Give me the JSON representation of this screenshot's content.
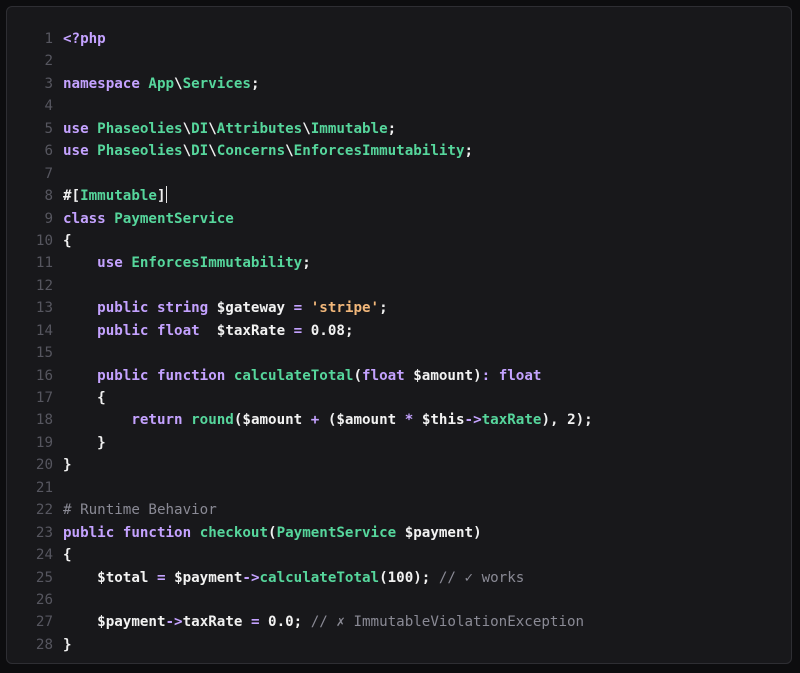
{
  "editor": {
    "lines": [
      [
        {
          "t": "kw",
          "v": "<?php"
        }
      ],
      [],
      [
        {
          "t": "kw",
          "v": "namespace"
        },
        {
          "t": "plain",
          "v": " "
        },
        {
          "t": "cls",
          "v": "App"
        },
        {
          "t": "sep",
          "v": "\\"
        },
        {
          "t": "cls",
          "v": "Services"
        },
        {
          "t": "plain",
          "v": ";"
        }
      ],
      [],
      [
        {
          "t": "kw",
          "v": "use"
        },
        {
          "t": "plain",
          "v": " "
        },
        {
          "t": "cls",
          "v": "Phaseolies"
        },
        {
          "t": "sep",
          "v": "\\"
        },
        {
          "t": "cls",
          "v": "DI"
        },
        {
          "t": "sep",
          "v": "\\"
        },
        {
          "t": "cls",
          "v": "Attributes"
        },
        {
          "t": "sep",
          "v": "\\"
        },
        {
          "t": "cls",
          "v": "Immutable"
        },
        {
          "t": "plain",
          "v": ";"
        }
      ],
      [
        {
          "t": "kw",
          "v": "use"
        },
        {
          "t": "plain",
          "v": " "
        },
        {
          "t": "cls",
          "v": "Phaseolies"
        },
        {
          "t": "sep",
          "v": "\\"
        },
        {
          "t": "cls",
          "v": "DI"
        },
        {
          "t": "sep",
          "v": "\\"
        },
        {
          "t": "cls",
          "v": "Concerns"
        },
        {
          "t": "sep",
          "v": "\\"
        },
        {
          "t": "cls",
          "v": "EnforcesImmutability"
        },
        {
          "t": "plain",
          "v": ";"
        }
      ],
      [],
      [
        {
          "t": "plain",
          "v": "#["
        },
        {
          "t": "cls",
          "v": "Immutable"
        },
        {
          "t": "plain",
          "v": "]"
        },
        {
          "t": "cursor",
          "v": ""
        }
      ],
      [
        {
          "t": "kw",
          "v": "class"
        },
        {
          "t": "plain",
          "v": " "
        },
        {
          "t": "cls",
          "v": "PaymentService"
        }
      ],
      [
        {
          "t": "plain",
          "v": "{"
        }
      ],
      [
        {
          "t": "plain",
          "v": "    "
        },
        {
          "t": "kw",
          "v": "use"
        },
        {
          "t": "plain",
          "v": " "
        },
        {
          "t": "cls",
          "v": "EnforcesImmutability"
        },
        {
          "t": "plain",
          "v": ";"
        }
      ],
      [],
      [
        {
          "t": "plain",
          "v": "    "
        },
        {
          "t": "kw",
          "v": "public"
        },
        {
          "t": "plain",
          "v": " "
        },
        {
          "t": "kw",
          "v": "string"
        },
        {
          "t": "plain",
          "v": " "
        },
        {
          "t": "var",
          "v": "$gateway"
        },
        {
          "t": "plain",
          "v": " "
        },
        {
          "t": "op",
          "v": "="
        },
        {
          "t": "plain",
          "v": " "
        },
        {
          "t": "str",
          "v": "'stripe'"
        },
        {
          "t": "plain",
          "v": ";"
        }
      ],
      [
        {
          "t": "plain",
          "v": "    "
        },
        {
          "t": "kw",
          "v": "public"
        },
        {
          "t": "plain",
          "v": " "
        },
        {
          "t": "kw",
          "v": "float"
        },
        {
          "t": "plain",
          "v": "  "
        },
        {
          "t": "var",
          "v": "$taxRate"
        },
        {
          "t": "plain",
          "v": " "
        },
        {
          "t": "op",
          "v": "="
        },
        {
          "t": "plain",
          "v": " "
        },
        {
          "t": "num",
          "v": "0.08"
        },
        {
          "t": "plain",
          "v": ";"
        }
      ],
      [],
      [
        {
          "t": "plain",
          "v": "    "
        },
        {
          "t": "kw",
          "v": "public"
        },
        {
          "t": "plain",
          "v": " "
        },
        {
          "t": "kw",
          "v": "function"
        },
        {
          "t": "plain",
          "v": " "
        },
        {
          "t": "fn",
          "v": "calculateTotal"
        },
        {
          "t": "plain",
          "v": "("
        },
        {
          "t": "kw",
          "v": "float"
        },
        {
          "t": "plain",
          "v": " "
        },
        {
          "t": "var",
          "v": "$amount"
        },
        {
          "t": "plain",
          "v": ")"
        },
        {
          "t": "op",
          "v": ":"
        },
        {
          "t": "plain",
          "v": " "
        },
        {
          "t": "kw",
          "v": "float"
        }
      ],
      [
        {
          "t": "plain",
          "v": "    {"
        }
      ],
      [
        {
          "t": "plain",
          "v": "        "
        },
        {
          "t": "kw",
          "v": "return"
        },
        {
          "t": "plain",
          "v": " "
        },
        {
          "t": "fn",
          "v": "round"
        },
        {
          "t": "plain",
          "v": "("
        },
        {
          "t": "var",
          "v": "$amount"
        },
        {
          "t": "plain",
          "v": " "
        },
        {
          "t": "op",
          "v": "+"
        },
        {
          "t": "plain",
          "v": " ("
        },
        {
          "t": "var",
          "v": "$amount"
        },
        {
          "t": "plain",
          "v": " "
        },
        {
          "t": "op",
          "v": "*"
        },
        {
          "t": "plain",
          "v": " "
        },
        {
          "t": "var",
          "v": "$this"
        },
        {
          "t": "op",
          "v": "->"
        },
        {
          "t": "fn",
          "v": "taxRate"
        },
        {
          "t": "plain",
          "v": "), "
        },
        {
          "t": "num",
          "v": "2"
        },
        {
          "t": "plain",
          "v": ");"
        }
      ],
      [
        {
          "t": "plain",
          "v": "    }"
        }
      ],
      [
        {
          "t": "plain",
          "v": "}"
        }
      ],
      [],
      [
        {
          "t": "cmt",
          "v": "# Runtime Behavior"
        }
      ],
      [
        {
          "t": "kw",
          "v": "public"
        },
        {
          "t": "plain",
          "v": " "
        },
        {
          "t": "kw",
          "v": "function"
        },
        {
          "t": "plain",
          "v": " "
        },
        {
          "t": "fn",
          "v": "checkout"
        },
        {
          "t": "plain",
          "v": "("
        },
        {
          "t": "cls",
          "v": "PaymentService"
        },
        {
          "t": "plain",
          "v": " "
        },
        {
          "t": "var",
          "v": "$payment"
        },
        {
          "t": "plain",
          "v": ")"
        }
      ],
      [
        {
          "t": "plain",
          "v": "{"
        }
      ],
      [
        {
          "t": "plain",
          "v": "    "
        },
        {
          "t": "var",
          "v": "$total"
        },
        {
          "t": "plain",
          "v": " "
        },
        {
          "t": "op",
          "v": "="
        },
        {
          "t": "plain",
          "v": " "
        },
        {
          "t": "var",
          "v": "$payment"
        },
        {
          "t": "op",
          "v": "->"
        },
        {
          "t": "fn",
          "v": "calculateTotal"
        },
        {
          "t": "plain",
          "v": "("
        },
        {
          "t": "num",
          "v": "100"
        },
        {
          "t": "plain",
          "v": "); "
        },
        {
          "t": "cmt",
          "v": "// ✓ works"
        }
      ],
      [],
      [
        {
          "t": "plain",
          "v": "    "
        },
        {
          "t": "var",
          "v": "$payment"
        },
        {
          "t": "op",
          "v": "->"
        },
        {
          "t": "plain",
          "v": "taxRate "
        },
        {
          "t": "op",
          "v": "="
        },
        {
          "t": "plain",
          "v": " "
        },
        {
          "t": "num",
          "v": "0.0"
        },
        {
          "t": "plain",
          "v": "; "
        },
        {
          "t": "cmt",
          "v": "// ✗ ImmutableViolationException"
        }
      ],
      [
        {
          "t": "plain",
          "v": "}"
        }
      ]
    ]
  }
}
